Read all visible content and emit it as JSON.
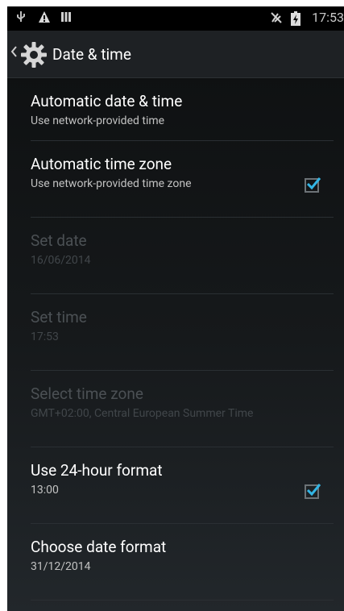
{
  "status_bar": {
    "time": "17:53",
    "icons": [
      "usb-icon",
      "warning-icon",
      "signal-bars-icon",
      "no-signal-icon",
      "battery-charging-icon"
    ]
  },
  "action_bar": {
    "title": "Date & time",
    "icon": "gear-icon"
  },
  "settings": [
    {
      "label": "Automatic date & time",
      "sub": "Use network-provided time",
      "enabled": true,
      "checkbox": false
    },
    {
      "label": "Automatic time zone",
      "sub": "Use network-provided time zone",
      "enabled": true,
      "checkbox": true,
      "checked": true
    },
    {
      "label": "Set date",
      "sub": "16/06/2014",
      "enabled": false,
      "checkbox": false
    },
    {
      "label": "Set time",
      "sub": "17:53",
      "enabled": false,
      "checkbox": false
    },
    {
      "label": "Select time zone",
      "sub": "GMT+02:00, Central European Summer Time",
      "enabled": false,
      "checkbox": false
    },
    {
      "label": "Use 24-hour format",
      "sub": "13:00",
      "enabled": true,
      "checkbox": true,
      "checked": true
    },
    {
      "label": "Choose date format",
      "sub": "31/12/2014",
      "enabled": true,
      "checkbox": false
    }
  ],
  "colors": {
    "accent": "#33b5e5",
    "background": "#111315",
    "disabled_text": "#4b5054"
  }
}
